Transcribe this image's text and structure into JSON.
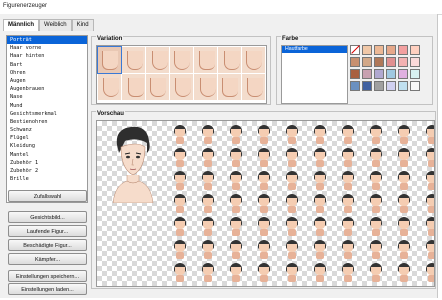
{
  "window": {
    "title": "Figurenerzeuger"
  },
  "tabs": [
    "Männlich",
    "Weiblich",
    "Kind"
  ],
  "parts": {
    "items": [
      "Porträt",
      "Haar vorne",
      "Haar hinten",
      "Bart",
      "Ohren",
      "Augen",
      "Augenbrauen",
      "Nase",
      "Mund",
      "Gesichtsmerkmal",
      "Bestienohren",
      "Schwanz",
      "Flügel",
      "Kleidung",
      "Mantel",
      "Zubehör 1",
      "Zubehör 2",
      "Brille"
    ],
    "selected_index": 0
  },
  "buttons": {
    "random": "Zufallswahl",
    "face": "Gesichtsbild...",
    "walking": "Laufende Figur...",
    "damaged": "Beschädigte Figur...",
    "fighter": "Kämpfer...",
    "save": "Einstellungen speichern...",
    "load": "Einstellungen laden..."
  },
  "variation": {
    "label": "Variation",
    "selected_index": 0
  },
  "farbe": {
    "label": "Farbe",
    "items": [
      "Hautfarbe"
    ],
    "swatches": [
      "none",
      "#f0c8a8",
      "#ecb895",
      "#e6a88a",
      "#f2a0a0",
      "#ffd0c0",
      "#c89070",
      "#d2a888",
      "#b07858",
      "#e09090",
      "#f3b2b2",
      "#fbdada",
      "#a86040",
      "#c8a0b0",
      "#b0a8d0",
      "#a0c8e0",
      "#e0b0e0",
      "#d8f0f0",
      "#6a90c0",
      "#4060a0",
      "#a0a0a0",
      "#d0d0f0",
      "#c0e0f0",
      "#f8f8f8"
    ]
  },
  "vorschau": {
    "label": "Vorschau"
  },
  "colors": {
    "accent": "#0a64d8",
    "hair": "#333333",
    "skin": "#f5cdb2"
  }
}
